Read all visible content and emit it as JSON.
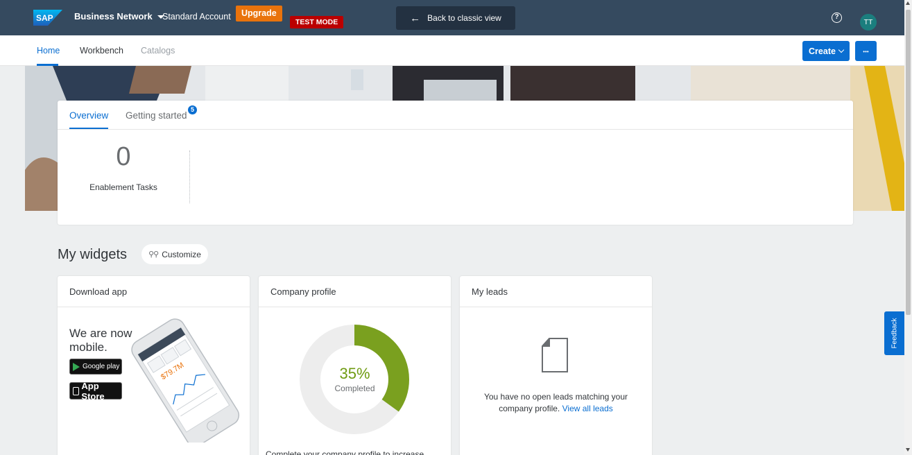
{
  "shell": {
    "logo_text": "SAP",
    "product": "Business Network",
    "account": "Standard Account",
    "upgrade_label": "Upgrade",
    "test_mode_label": "TEST MODE",
    "back_classic_label": "Back to classic view",
    "help_icon": "help-circle-icon",
    "avatar_initials": "TT",
    "colors": {
      "shell_bg": "#354a5f",
      "upgrade": "#e9730c",
      "test_mode": "#bb0000",
      "avatar": "#1b7e7e"
    }
  },
  "nav": {
    "tabs": [
      {
        "label": "Home",
        "active": true
      },
      {
        "label": "Workbench",
        "active": false
      },
      {
        "label": "Catalogs",
        "active": false,
        "disabled": true
      }
    ],
    "create_label": "Create",
    "more_label": "•••"
  },
  "overview": {
    "tabs": [
      {
        "label": "Overview",
        "active": true
      },
      {
        "label": "Getting started",
        "badge": "5"
      }
    ],
    "kpi_value": "0",
    "kpi_label": "Enablement Tasks"
  },
  "widgets": {
    "title": "My widgets",
    "customize_label": "Customize",
    "download_app": {
      "title": "Download app",
      "headline": "We are now mobile.",
      "google_play": "Google play",
      "app_store": "App Store",
      "phone_amount": "$79.7M"
    },
    "company_profile": {
      "title": "Company profile",
      "percent": "35%",
      "percent_value": 35,
      "status": "Completed",
      "description": "Complete your company profile to increase"
    },
    "my_leads": {
      "title": "My leads",
      "message": "You have no open leads matching your company profile.",
      "link": "View all leads"
    }
  },
  "feedback_label": "Feedback",
  "accent_color": "#0a6ed1",
  "progress_color": "#7aa01f"
}
